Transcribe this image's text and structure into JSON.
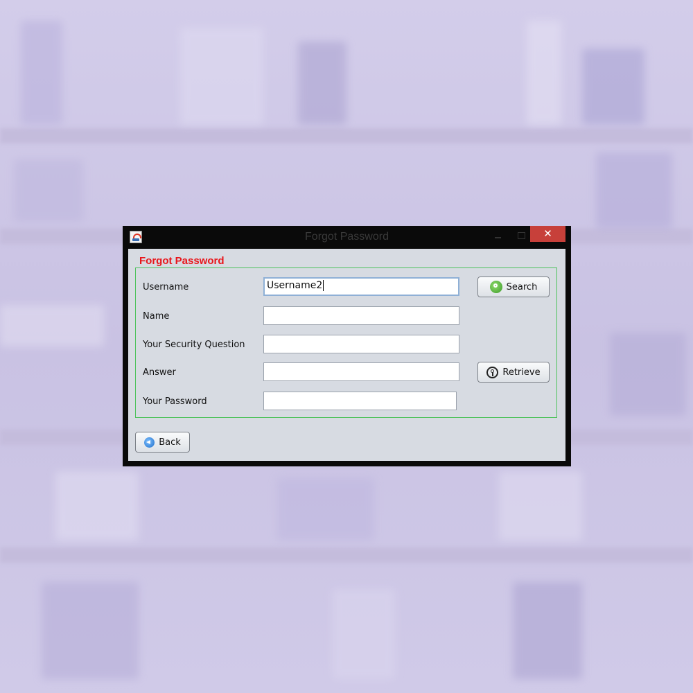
{
  "window": {
    "title": "Forgot Password",
    "close_glyph": "✕"
  },
  "form": {
    "section_title": "Forgot Password",
    "fields": {
      "username": {
        "label": "Username",
        "value": "Username2"
      },
      "name": {
        "label": "Name",
        "value": ""
      },
      "security_question": {
        "label": "Your Security Question",
        "value": ""
      },
      "answer": {
        "label": "Answer",
        "value": ""
      },
      "password": {
        "label": "Your Password",
        "value": ""
      }
    },
    "buttons": {
      "search": {
        "label": "Search",
        "icon": "search-icon"
      },
      "retrieve": {
        "label": "Retrieve",
        "icon": "key-icon"
      },
      "back": {
        "label": "Back",
        "icon": "back-arrow-icon"
      }
    }
  },
  "colors": {
    "section_title": "#e8161b",
    "group_border": "#4cc25a",
    "close_button": "#c7403a"
  }
}
